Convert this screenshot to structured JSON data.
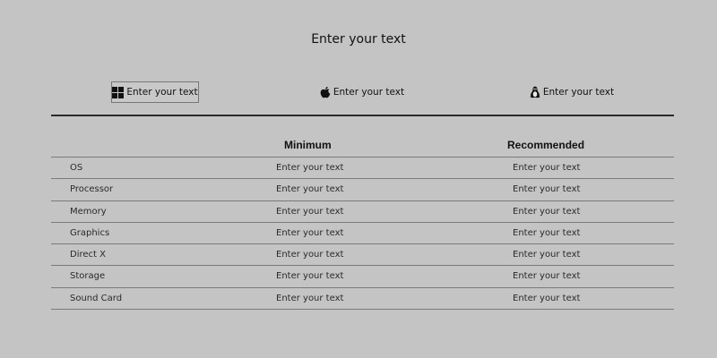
{
  "page": {
    "title": "Enter your text"
  },
  "platforms": [
    {
      "name": "Windows",
      "label": "Enter your text",
      "icon": "windows-icon",
      "active": true
    },
    {
      "name": "Mac",
      "label": "Enter your text",
      "icon": "apple-icon",
      "active": false
    },
    {
      "name": "Linux",
      "label": "Enter your text",
      "icon": "linux-icon",
      "active": false
    }
  ],
  "table": {
    "headers": [
      "",
      "Minimum",
      "Recommended"
    ],
    "rows": [
      {
        "label": "OS",
        "minimum": "Enter your text",
        "recommended": "Enter your text"
      },
      {
        "label": "Processor",
        "minimum": "Enter your text",
        "recommended": "Enter your text"
      },
      {
        "label": "Memory",
        "minimum": "Enter your text",
        "recommended": "Enter your text"
      },
      {
        "label": "Graphics",
        "minimum": "Enter your text",
        "recommended": "Enter your text"
      },
      {
        "label": "Direct X",
        "minimum": "Enter your text",
        "recommended": "Enter your text"
      },
      {
        "label": "Storage",
        "minimum": "Enter your text",
        "recommended": "Enter your text"
      },
      {
        "label": "Sound Card",
        "minimum": "Enter your text",
        "recommended": "Enter your text"
      }
    ]
  },
  "colors": {
    "background": "#c4c4c4",
    "text": "#1a1a1a",
    "divider": "#2a2a2a",
    "row_border": "#7a7a7a"
  }
}
